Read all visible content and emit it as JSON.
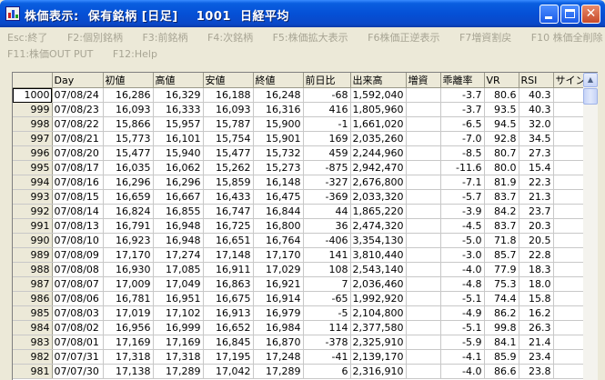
{
  "window": {
    "title": "株価表示:  保有銘柄 [日足]    1001  日経平均",
    "controls": {
      "minimize": "_",
      "maximize": "□",
      "close": "✕"
    }
  },
  "menu": {
    "row1": [
      "Esc:終了",
      "F2:個別銘柄",
      "F3:前銘柄",
      "F4:次銘柄",
      "F5:株価拡大表示",
      "F6株価正逆表示",
      "F7増資割戻",
      "F10 株価全削除"
    ],
    "row2": [
      "F11:株価OUT PUT",
      "F12:Help"
    ]
  },
  "table": {
    "columns": [
      "",
      "Day",
      "初値",
      "高値",
      "安値",
      "終値",
      "前日比",
      "出来高",
      "増資",
      "乖離率",
      "VR",
      "RSI",
      "サイン"
    ],
    "rows": [
      [
        "1000",
        "07/08/24",
        "16,286",
        "16,329",
        "16,188",
        "16,248",
        "-68",
        "1,592,040",
        "",
        "-3.7",
        "80.6",
        "40.3",
        ""
      ],
      [
        "999",
        "07/08/23",
        "16,093",
        "16,333",
        "16,093",
        "16,316",
        "416",
        "1,805,960",
        "",
        "-3.7",
        "93.5",
        "40.3",
        ""
      ],
      [
        "998",
        "07/08/22",
        "15,866",
        "15,957",
        "15,787",
        "15,900",
        "-1",
        "1,661,020",
        "",
        "-6.5",
        "94.5",
        "32.0",
        ""
      ],
      [
        "997",
        "07/08/21",
        "15,773",
        "16,101",
        "15,754",
        "15,901",
        "169",
        "2,035,260",
        "",
        "-7.0",
        "92.8",
        "34.5",
        ""
      ],
      [
        "996",
        "07/08/20",
        "15,477",
        "15,940",
        "15,477",
        "15,732",
        "459",
        "2,244,960",
        "",
        "-8.5",
        "80.7",
        "27.3",
        ""
      ],
      [
        "995",
        "07/08/17",
        "16,035",
        "16,062",
        "15,262",
        "15,273",
        "-875",
        "2,942,470",
        "",
        "-11.6",
        "80.0",
        "15.4",
        ""
      ],
      [
        "994",
        "07/08/16",
        "16,296",
        "16,296",
        "15,859",
        "16,148",
        "-327",
        "2,676,800",
        "",
        "-7.1",
        "81.9",
        "22.3",
        ""
      ],
      [
        "993",
        "07/08/15",
        "16,659",
        "16,667",
        "16,433",
        "16,475",
        "-369",
        "2,033,320",
        "",
        "-5.7",
        "83.7",
        "21.3",
        ""
      ],
      [
        "992",
        "07/08/14",
        "16,824",
        "16,855",
        "16,747",
        "16,844",
        "44",
        "1,865,220",
        "",
        "-3.9",
        "84.2",
        "23.7",
        ""
      ],
      [
        "991",
        "07/08/13",
        "16,791",
        "16,948",
        "16,725",
        "16,800",
        "36",
        "2,474,320",
        "",
        "-4.5",
        "83.7",
        "20.3",
        ""
      ],
      [
        "990",
        "07/08/10",
        "16,923",
        "16,948",
        "16,651",
        "16,764",
        "-406",
        "3,354,130",
        "",
        "-5.0",
        "71.8",
        "20.5",
        ""
      ],
      [
        "989",
        "07/08/09",
        "17,170",
        "17,274",
        "17,148",
        "17,170",
        "141",
        "3,810,440",
        "",
        "-3.0",
        "85.7",
        "22.8",
        ""
      ],
      [
        "988",
        "07/08/08",
        "16,930",
        "17,085",
        "16,911",
        "17,029",
        "108",
        "2,543,140",
        "",
        "-4.0",
        "77.9",
        "18.3",
        ""
      ],
      [
        "987",
        "07/08/07",
        "17,009",
        "17,049",
        "16,863",
        "16,921",
        "7",
        "2,036,460",
        "",
        "-4.8",
        "75.3",
        "18.0",
        ""
      ],
      [
        "986",
        "07/08/06",
        "16,781",
        "16,951",
        "16,675",
        "16,914",
        "-65",
        "1,992,920",
        "",
        "-5.1",
        "74.4",
        "15.8",
        ""
      ],
      [
        "985",
        "07/08/03",
        "17,019",
        "17,102",
        "16,913",
        "16,979",
        "-5",
        "2,104,800",
        "",
        "-4.9",
        "86.2",
        "16.2",
        ""
      ],
      [
        "984",
        "07/08/02",
        "16,956",
        "16,999",
        "16,652",
        "16,984",
        "114",
        "2,377,580",
        "",
        "-5.1",
        "99.8",
        "26.3",
        ""
      ],
      [
        "983",
        "07/08/01",
        "17,169",
        "17,169",
        "16,845",
        "16,870",
        "-378",
        "2,325,910",
        "",
        "-5.9",
        "84.1",
        "21.4",
        ""
      ],
      [
        "982",
        "07/07/31",
        "17,318",
        "17,318",
        "17,195",
        "17,248",
        "-41",
        "2,139,170",
        "",
        "-4.1",
        "85.9",
        "23.4",
        ""
      ],
      [
        "981",
        "07/07/30",
        "17,138",
        "17,289",
        "17,042",
        "17,289",
        "6",
        "2,316,910",
        "",
        "-4.0",
        "86.6",
        "23.8",
        ""
      ]
    ]
  }
}
